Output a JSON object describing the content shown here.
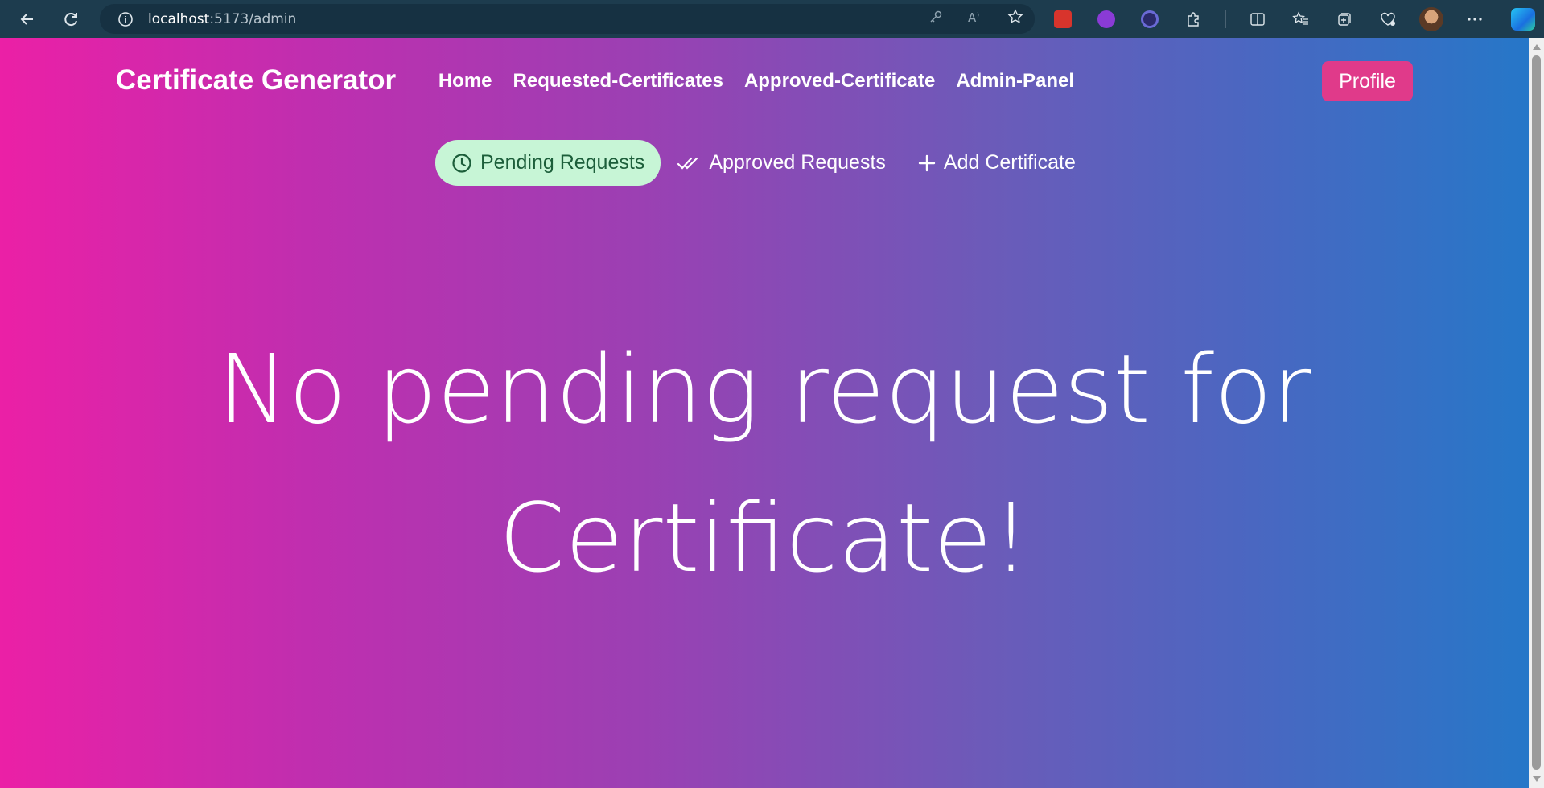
{
  "browser": {
    "url_host": "localhost",
    "url_path": ":5173/admin"
  },
  "navbar": {
    "brand": "Certificate Generator",
    "links": [
      "Home",
      "Requested-Certificates",
      "Approved-Certificate",
      "Admin-Panel"
    ],
    "profile_label": "Profile"
  },
  "tabs": [
    {
      "label": "Pending Requests",
      "icon": "clock-icon",
      "active": true
    },
    {
      "label": "Approved Requests",
      "icon": "double-check-icon",
      "active": false
    },
    {
      "label": "Add Certificate",
      "icon": "plus-icon",
      "active": false
    }
  ],
  "message": {
    "line1": "No pending request for",
    "line2": "Certificate!"
  },
  "colors": {
    "gradient_start": "#eb20a6",
    "gradient_end": "#2677c8",
    "profile_button": "#e03a8a",
    "active_tab_bg": "#c7f5d6",
    "active_tab_text": "#1c5e3a"
  }
}
